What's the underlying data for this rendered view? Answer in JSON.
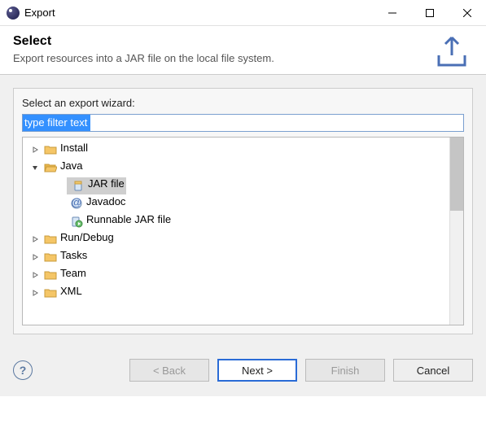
{
  "window": {
    "title": "Export"
  },
  "header": {
    "heading": "Select",
    "subtitle": "Export resources into a JAR file on the local file system."
  },
  "panel": {
    "label": "Select an export wizard:",
    "filter_placeholder": "type filter text"
  },
  "tree": {
    "items": [
      {
        "label": "Install",
        "expandable": true,
        "expanded": false,
        "depth": 1,
        "kind": "folder-closed"
      },
      {
        "label": "Java",
        "expandable": true,
        "expanded": true,
        "depth": 1,
        "kind": "folder-open"
      },
      {
        "label": "JAR file",
        "expandable": false,
        "depth": 2,
        "kind": "jar",
        "selected": true
      },
      {
        "label": "Javadoc",
        "expandable": false,
        "depth": 2,
        "kind": "javadoc"
      },
      {
        "label": "Runnable JAR file",
        "expandable": false,
        "depth": 2,
        "kind": "runjar"
      },
      {
        "label": "Run/Debug",
        "expandable": true,
        "expanded": false,
        "depth": 1,
        "kind": "folder-closed"
      },
      {
        "label": "Tasks",
        "expandable": true,
        "expanded": false,
        "depth": 1,
        "kind": "folder-closed"
      },
      {
        "label": "Team",
        "expandable": true,
        "expanded": false,
        "depth": 1,
        "kind": "folder-closed"
      },
      {
        "label": "XML",
        "expandable": true,
        "expanded": false,
        "depth": 1,
        "kind": "folder-closed"
      }
    ]
  },
  "buttons": {
    "back": "< Back",
    "next": "Next >",
    "finish": "Finish",
    "cancel": "Cancel"
  },
  "icons": {
    "folder_closed": "folder-closed-icon",
    "folder_open": "folder-open-icon",
    "jar": "jar-file-icon",
    "javadoc": "javadoc-icon",
    "runjar": "runnable-jar-icon"
  }
}
